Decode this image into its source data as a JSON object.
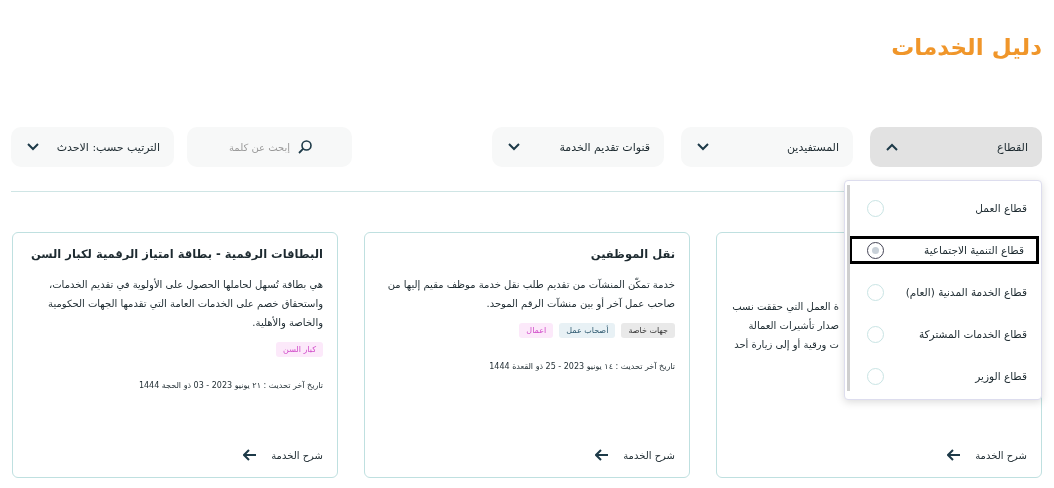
{
  "page_title": "دليل الخدمات",
  "filters": [
    {
      "kind": "dropdown",
      "label": "القطاع",
      "expanded": true
    },
    {
      "kind": "dropdown",
      "label": "المستفيدين",
      "expanded": false
    },
    {
      "kind": "dropdown",
      "label": "قنوات تقديم الخدمة",
      "expanded": false
    }
  ],
  "search": {
    "placeholder": "إبحث عن كلمة"
  },
  "sort": {
    "label": "الترتيب حسب: الاحدث"
  },
  "sector_menu": {
    "options": [
      {
        "label": "قطاع العمل",
        "selected": false
      },
      {
        "label": "قطاع التنمية الاجتماعية",
        "selected": true
      },
      {
        "label": "قطاع الخدمة المدنية (العام)",
        "selected": false
      },
      {
        "label": "قطاع الخدمات المشتركة",
        "selected": false
      },
      {
        "label": "قطاع الوزير",
        "selected": false
      }
    ]
  },
  "cards": [
    {
      "kind": "covered",
      "description_lines": [
        "ة العمل التي حققت نسب",
        "صدار تأشيرات العمالة",
        "ت ورقية أو إلى زيارة أحد"
      ],
      "link": "شرح الخدمة"
    },
    {
      "kind": "full",
      "title": "نقل الموظفين",
      "description": "خدمة تمكّن المنشآت من تقديم طلب نقل خدمة موظف مقيم إليها من صاحب عمل آخر أو بين منشآت الرقم الموحد.",
      "tags": [
        {
          "label": "جهات خاصة",
          "color": "#e9e9e9",
          "kind": "neutral"
        },
        {
          "label": "أصحاب عمل",
          "color": "#e8f1f5",
          "kind": "info"
        },
        {
          "label": "اعمال",
          "color": "#fce9fa",
          "kind": "accent"
        }
      ],
      "date": "تاريخ آخر تحديث : ١٤ يونيو 2023 - 25 ذو القعدة 1444",
      "link": "شرح الخدمة"
    },
    {
      "kind": "full",
      "title": "البطاقات الرقمية - بطاقة امتياز الرقمية لكبار السن",
      "description": "هي بطاقة تُسهل لحاملها الحصول على الأولوية في تقديم الخدمات، واستحقاق خصم على الخدمات العامة التي تقدمها الجهات الحكومية والخاصة والأهلية.",
      "tags": [
        {
          "label": "كبار السن",
          "color": "#fce9fa",
          "kind": "accent"
        }
      ],
      "date": "تاريخ آخر تحديث : ٢١ يونيو 2023 - 03 ذو الحجة 1444",
      "link": "شرح الخدمة"
    }
  ]
}
